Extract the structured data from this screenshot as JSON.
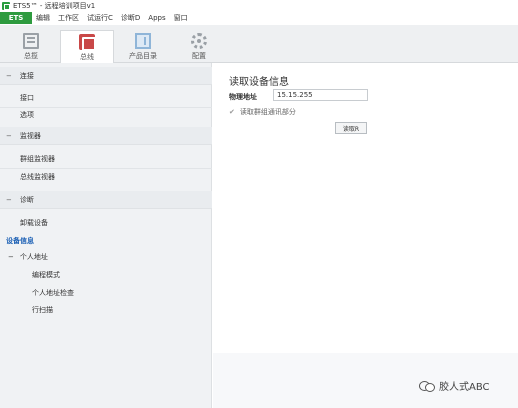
{
  "window": {
    "title": "ETS5™ - 远程培训项目v1"
  },
  "menubar": {
    "ets_label": "ETS",
    "items": [
      "编辑",
      "工作区",
      "试运行C",
      "诊断D",
      "Apps",
      "窗口"
    ]
  },
  "ribbon": {
    "tabs": [
      {
        "label": "总揽",
        "icon": "overview-icon"
      },
      {
        "label": "总线",
        "icon": "bus-icon",
        "active": true
      },
      {
        "label": "产品目录",
        "icon": "catalog-icon"
      },
      {
        "label": "配置",
        "icon": "gear-icon"
      }
    ]
  },
  "sidebar": {
    "sections": [
      {
        "title": "连接",
        "items": [
          "接口",
          "选项"
        ]
      },
      {
        "title": "监视器",
        "items": [
          "群组监视器",
          "总线监视器"
        ]
      },
      {
        "title": "诊断",
        "items": [
          "卸载设备",
          "设备信息"
        ],
        "active_item": "设备信息"
      }
    ],
    "personal_address": {
      "title": "个人地址",
      "items": [
        "编程模式",
        "个人地址检查",
        "行扫描"
      ]
    }
  },
  "main": {
    "page_title": "读取设备信息",
    "physical_address_label": "物理地址",
    "physical_address_value": "15.15.255",
    "checkbox_label": "读取群组通讯部分",
    "read_button_label": "读取R"
  },
  "watermark": {
    "text": "胶人式ABC"
  }
}
